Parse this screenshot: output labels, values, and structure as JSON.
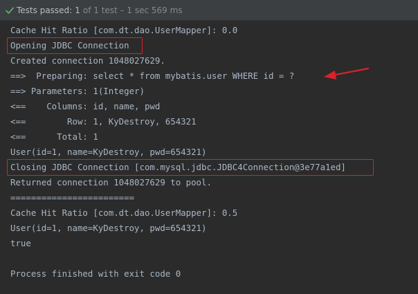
{
  "header": {
    "status": "Tests passed:",
    "count": "1",
    "detail": "of 1 test – 1 sec 569 ms",
    "status_color": "#5ead6b"
  },
  "console": {
    "lines": [
      "Cache Hit Ratio [com.dt.dao.UserMapper]: 0.0",
      "Opening JDBC Connection",
      "Created connection 1048027629.",
      "==>  Preparing: select * from mybatis.user WHERE id = ?",
      "==> Parameters: 1(Integer)",
      "<==    Columns: id, name, pwd",
      "<==        Row: 1, KyDestroy, 654321",
      "<==      Total: 1",
      "User(id=1, name=KyDestroy, pwd=654321)",
      "Closing JDBC Connection [com.mysql.jdbc.JDBC4Connection@3e77a1ed]",
      "Returned connection 1048027629 to pool.",
      "========================",
      "Cache Hit Ratio [com.dt.dao.UserMapper]: 0.5",
      "User(id=1, name=KyDestroy, pwd=654321)",
      "true",
      "",
      "Process finished with exit code 0"
    ]
  },
  "annotation_color": "#d9232b"
}
